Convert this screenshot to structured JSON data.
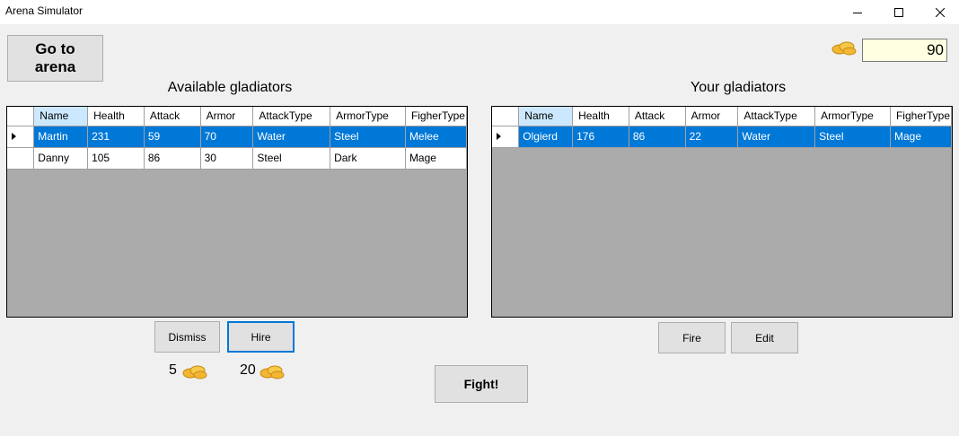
{
  "window": {
    "title": "Arena Simulator"
  },
  "buttons": {
    "go_to_arena": "Go to\narena",
    "dismiss": "Dismiss",
    "hire": "Hire",
    "fire": "Fire",
    "edit": "Edit",
    "fight": "Fight!"
  },
  "gold": {
    "value": "90",
    "icon": "coin-stack-icon"
  },
  "available": {
    "title": "Available gladiators",
    "columns": [
      "Name",
      "Health",
      "Attack",
      "Armor",
      "AttackType",
      "ArmorType",
      "FigherType"
    ],
    "rows": [
      [
        "Martin",
        "231",
        "59",
        "70",
        "Water",
        "Steel",
        "Melee"
      ],
      [
        "Danny",
        "105",
        "86",
        "30",
        "Steel",
        "Dark",
        "Mage"
      ]
    ],
    "selected_row": 0
  },
  "yours": {
    "title": "Your gladiators",
    "columns": [
      "Name",
      "Health",
      "Attack",
      "Armor",
      "AttackType",
      "ArmorType",
      "FigherType"
    ],
    "rows": [
      [
        "Olgierd",
        "176",
        "86",
        "22",
        "Water",
        "Steel",
        "Mage"
      ]
    ],
    "selected_row": 0
  },
  "costs": {
    "dismiss": "5",
    "hire": "20"
  },
  "colors": {
    "selection": "#0078d7",
    "grid_background": "#ababab",
    "gold_box": "#ffffe1"
  }
}
